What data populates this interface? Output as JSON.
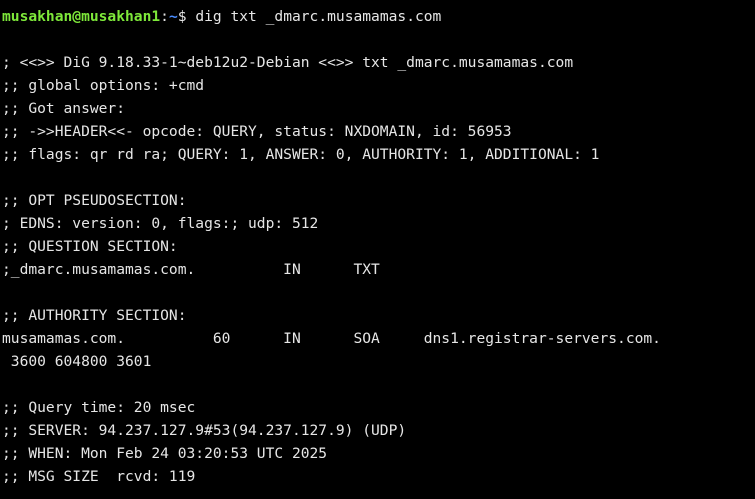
{
  "prompt": {
    "user_host": "musakhan@musakhan1",
    "colon": ":",
    "path": "~",
    "symbol": "$ ",
    "command": "dig txt _dmarc.musamamas.com"
  },
  "output": [
    "; <<>> DiG 9.18.33-1~deb12u2-Debian <<>> txt _dmarc.musamamas.com",
    ";; global options: +cmd",
    ";; Got answer:",
    ";; ->>HEADER<<- opcode: QUERY, status: NXDOMAIN, id: 56953",
    ";; flags: qr rd ra; QUERY: 1, ANSWER: 0, AUTHORITY: 1, ADDITIONAL: 1",
    ";; OPT PSEUDOSECTION:",
    "; EDNS: version: 0, flags:; udp: 512",
    ";; QUESTION SECTION:",
    ";_dmarc.musamamas.com.          IN      TXT",
    ";; AUTHORITY SECTION:",
    "musamamas.com.          60      IN      SOA     dns1.registrar-servers.com.",
    " 3600 604800 3601",
    ";; Query time: 20 msec",
    ";; SERVER: 94.237.127.9#53(94.237.127.9) (UDP)",
    ";; WHEN: Mon Feb 24 03:20:53 UTC 2025",
    ";; MSG SIZE  rcvd: 119"
  ],
  "colors": {
    "background": "#000000",
    "text": "#e6e6e6",
    "user_host": "#7ee83a",
    "path": "#4a8cff"
  }
}
